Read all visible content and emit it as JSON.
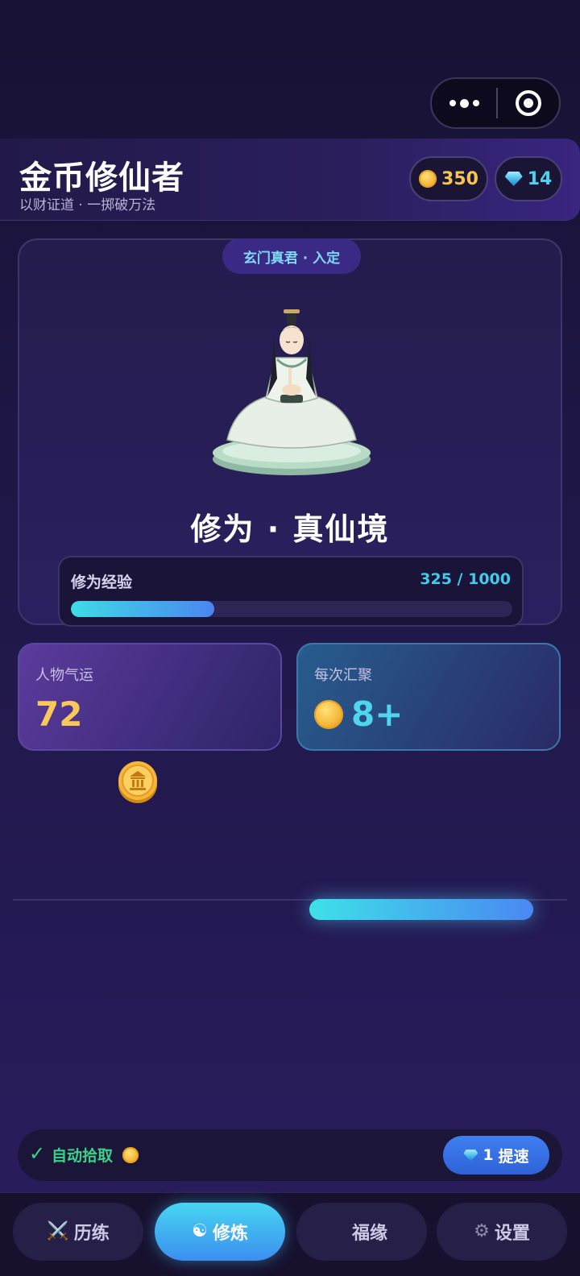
{
  "header": {
    "title": "金币修仙者",
    "subtitle": "以财证道 · 一掷破万法",
    "coins": "350",
    "gems": "14"
  },
  "character": {
    "realm_badge": "玄门真君 · 入定",
    "cultivation_title": "修为 · 真仙境",
    "exp_label": "修为经验",
    "exp_text": "325 / 1000",
    "exp_progress": 0.325
  },
  "stats": {
    "fortune_label": "人物气运",
    "fortune_value": "72",
    "gather_label": "每次汇聚",
    "gather_value": "8+"
  },
  "auto_pickup": {
    "check": "✓",
    "label": "自动拾取",
    "speed_cost": "1",
    "speed_label": "提速"
  },
  "tabs": [
    {
      "label": "历练",
      "icon": "crossed-swords-icon",
      "glyph": "⚔️"
    },
    {
      "label": "修炼",
      "icon": "yin-yang-icon",
      "glyph": "☯"
    },
    {
      "label": "福缘",
      "icon": "fortune-icon",
      "glyph": ""
    },
    {
      "label": "设置",
      "icon": "gear-icon",
      "glyph": "⚙"
    }
  ],
  "colors": {
    "accent_cyan": "#41cbe8",
    "gold": "#f9c85a",
    "green": "#39d48a",
    "bg": "#1d1643"
  }
}
